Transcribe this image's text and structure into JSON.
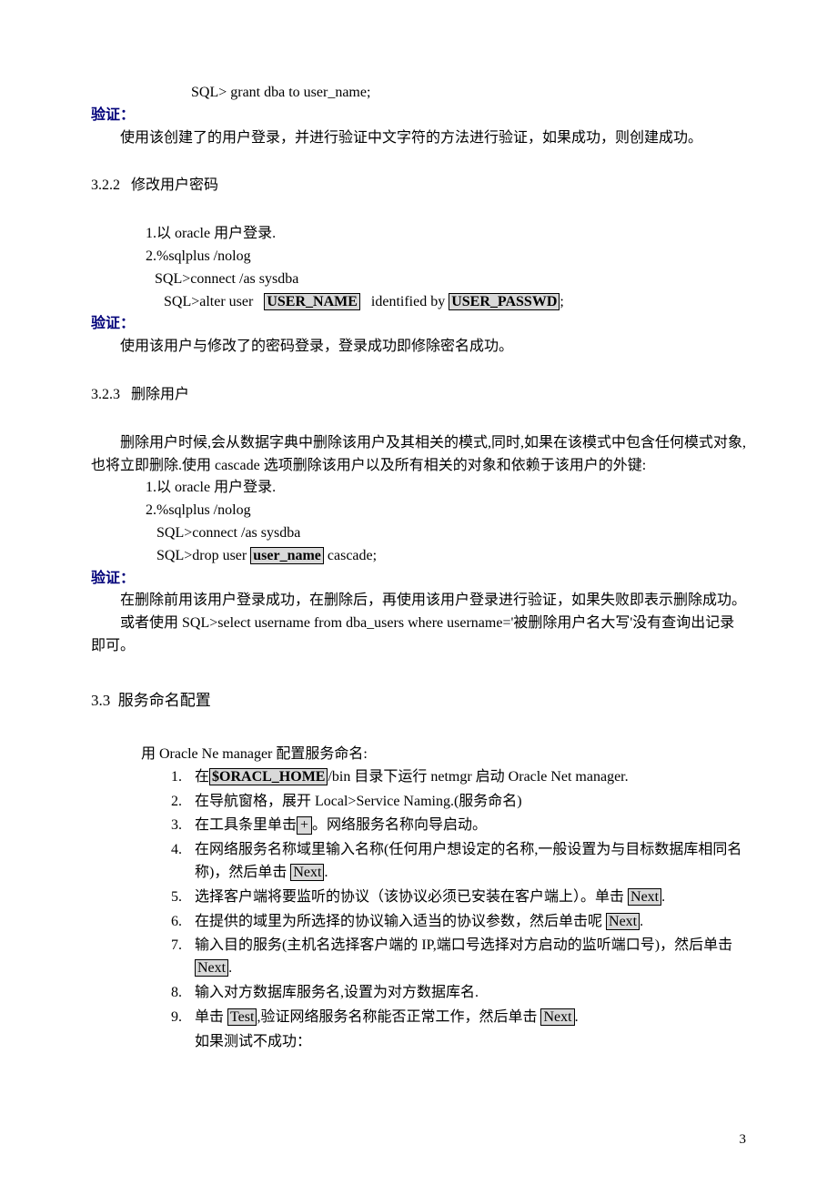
{
  "line_sql_grant": "SQL> grant dba to user_name;",
  "verify_label": "验证：",
  "para_grant_verify": "使用该创建了的用户登录，并进行验证中文字符的方法进行验证，如果成功，则创建成功。",
  "sec_322_num": "3.2.2",
  "sec_322_title": "修改用户密码",
  "s322_l1": "1.以 oracle 用户登录.",
  "s322_l2": "2.%sqlplus /nolog",
  "s322_l3": "SQL>connect /as sysdba",
  "s322_l4a": "SQL>alter user",
  "s322_box1": "USER_NAME",
  "s322_l4b": "identified by",
  "s322_box2": "USER_PASSWD",
  "s322_l4c": ";",
  "para_322_verify": "使用该用户与修改了的密码登录，登录成功即修除密名成功。",
  "sec_323_num": "3.2.3",
  "sec_323_title": "删除用户",
  "para_323_intro": "删除用户时候,会从数据字典中删除该用户及其相关的模式,同时,如果在该模式中包含任何模式对象,也将立即删除.使用 cascade 选项删除该用户以及所有相关的对象和依赖于该用户的外键:",
  "s323_l1": "1.以 oracle 用户登录.",
  "s323_l2": "2.%sqlplus /nolog",
  "s323_l3": "SQL>connect /as sysdba",
  "s323_l4a": "SQL>drop user ",
  "s323_box": " user_name",
  "s323_l4b": " cascade;",
  "para_323_verify1": "在删除前用该用户登录成功，在删除后，再使用该用户登录进行验证，如果失败即表示删除成功。",
  "para_323_verify2": "或者使用 SQL>select username from dba_users where username='被删除用户名大写'没有查询出记录即可。",
  "sec_33_num": "3.3",
  "sec_33_title": "服务命名配置",
  "s33_intro": "用 Oracle Ne manager 配置服务命名:",
  "steps": [
    {
      "n": "1.",
      "pre": "在",
      "box": "$ORACL_HOME",
      "post": "/bin 目录下运行 netmgr  启动 Oracle Net manager."
    },
    {
      "n": "2.",
      "text": "在导航窗格，展开 Local>Service Naming.(服务命名)"
    },
    {
      "n": "3.",
      "pre": "在工具条里单击",
      "box": "+",
      "post": "。网络服务名称向导启动。"
    },
    {
      "n": "4.",
      "pre": "在网络服务名称域里输入名称(任何用户想设定的名称,一般设置为与目标数据库相同名称)，然后单击 ",
      "box": "Next",
      "post": "."
    },
    {
      "n": "5.",
      "pre": "选择客户端将要监听的协议（该协议必须已安装在客户端上）。单击 ",
      "box": "Next",
      "post": "."
    },
    {
      "n": "6.",
      "pre": "在提供的域里为所选择的协议输入适当的协议参数，然后单击呢 ",
      "box": "Next",
      "post": "."
    },
    {
      "n": "7.",
      "pre": "输入目的服务(主机名选择客户端的 IP,端口号选择对方启动的监听端口号)，然后单击 ",
      "box": "Next",
      "post": "."
    },
    {
      "n": "8.",
      "text": "输入对方数据库服务名,设置为对方数据库名."
    },
    {
      "n": "9.",
      "pre": "单击 ",
      "box": "Test",
      "mid": ",验证网络服务名称能否正常工作，然后单击 ",
      "box2": "Next",
      "post": "."
    }
  ],
  "s33_tail": "如果测试不成功：",
  "page_number": "3"
}
